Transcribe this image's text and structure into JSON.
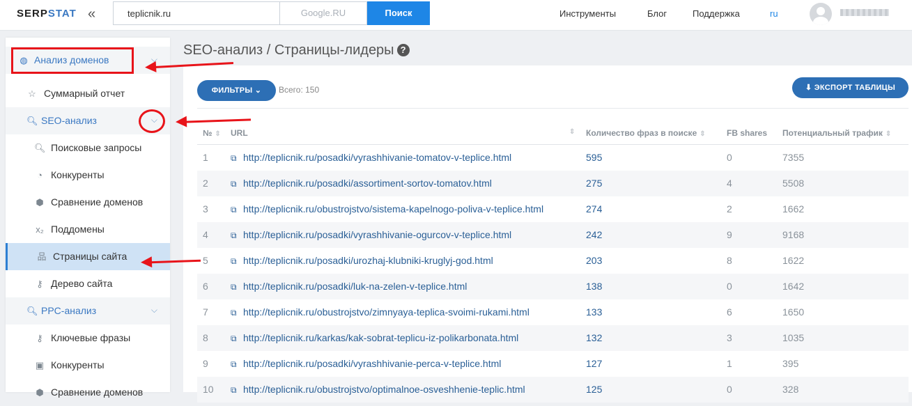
{
  "header": {
    "logo": {
      "part1": "SERP",
      "part2": "STAT"
    },
    "collapse_icon": "double-chevron-left-icon",
    "search_value": "teplicnik.ru",
    "database": "Google.RU",
    "search_button": "Поиск",
    "nav": [
      "Инструменты",
      "Блог",
      "Поддержка",
      "ru"
    ]
  },
  "sidebar": {
    "domain_analysis": "Анализ доменов",
    "items": [
      {
        "label": "Суммарный отчет",
        "icon": "star-icon"
      },
      {
        "label": "SEO-анализ",
        "icon": "search-icon"
      },
      {
        "label": "Поисковые запросы",
        "icon": "search-icon"
      },
      {
        "label": "Конкуренты",
        "icon": "pie-chart-icon"
      },
      {
        "label": "Сравнение доменов",
        "icon": "cubes-icon"
      },
      {
        "label": "Поддомены",
        "icon": "subscript-icon"
      },
      {
        "label": "Страницы сайта",
        "icon": "sitemap-icon"
      },
      {
        "label": "Дерево сайта",
        "icon": "key-icon"
      },
      {
        "label": "PPC-анализ",
        "icon": "search-icon"
      },
      {
        "label": "Ключевые фразы",
        "icon": "key-icon"
      },
      {
        "label": "Конкуренты",
        "icon": "money-icon"
      },
      {
        "label": "Сравнение доменов",
        "icon": "cubes-icon"
      }
    ]
  },
  "main": {
    "title": "SEO-анализ / Страницы-лидеры",
    "filters_button": "ФИЛЬТРЫ",
    "total": "Всего: 150",
    "export_button": "ЭКСПОРТ ТАБЛИЦЫ",
    "columns": [
      "№",
      "URL",
      "Количество фраз в поиске",
      "FB shares",
      "Потенциальный трафик"
    ],
    "rows": [
      {
        "n": "1",
        "url": "http://teplicnik.ru/posadki/vyrashhivanie-tomatov-v-teplice.html",
        "phrases": "595",
        "fb": "0",
        "traffic": "7355"
      },
      {
        "n": "2",
        "url": "http://teplicnik.ru/posadki/assortiment-sortov-tomatov.html",
        "phrases": "275",
        "fb": "4",
        "traffic": "5508"
      },
      {
        "n": "3",
        "url": "http://teplicnik.ru/obustrojstvo/sistema-kapelnogo-poliva-v-teplice.html",
        "phrases": "274",
        "fb": "2",
        "traffic": "1662"
      },
      {
        "n": "4",
        "url": "http://teplicnik.ru/posadki/vyrashhivanie-ogurcov-v-teplice.html",
        "phrases": "242",
        "fb": "9",
        "traffic": "9168"
      },
      {
        "n": "5",
        "url": "http://teplicnik.ru/posadki/urozhaj-klubniki-kruglyj-god.html",
        "phrases": "203",
        "fb": "8",
        "traffic": "1622"
      },
      {
        "n": "6",
        "url": "http://teplicnik.ru/posadki/luk-na-zelen-v-teplice.html",
        "phrases": "138",
        "fb": "0",
        "traffic": "1642"
      },
      {
        "n": "7",
        "url": "http://teplicnik.ru/obustrojstvo/zimnyaya-teplica-svoimi-rukami.html",
        "phrases": "133",
        "fb": "6",
        "traffic": "1650"
      },
      {
        "n": "8",
        "url": "http://teplicnik.ru/karkas/kak-sobrat-teplicu-iz-polikarbonata.html",
        "phrases": "132",
        "fb": "3",
        "traffic": "1035"
      },
      {
        "n": "9",
        "url": "http://teplicnik.ru/posadki/vyrashhivanie-perca-v-teplice.html",
        "phrases": "127",
        "fb": "1",
        "traffic": "395"
      },
      {
        "n": "10",
        "url": "http://teplicnik.ru/obustrojstvo/optimalnoe-osveshhenie-teplic.html",
        "phrases": "125",
        "fb": "0",
        "traffic": "328"
      }
    ]
  },
  "colors": {
    "accent": "#1e86e6",
    "button": "#2d6fb5",
    "annotation": "#e8141a",
    "active_item": "#cfe2f5"
  }
}
